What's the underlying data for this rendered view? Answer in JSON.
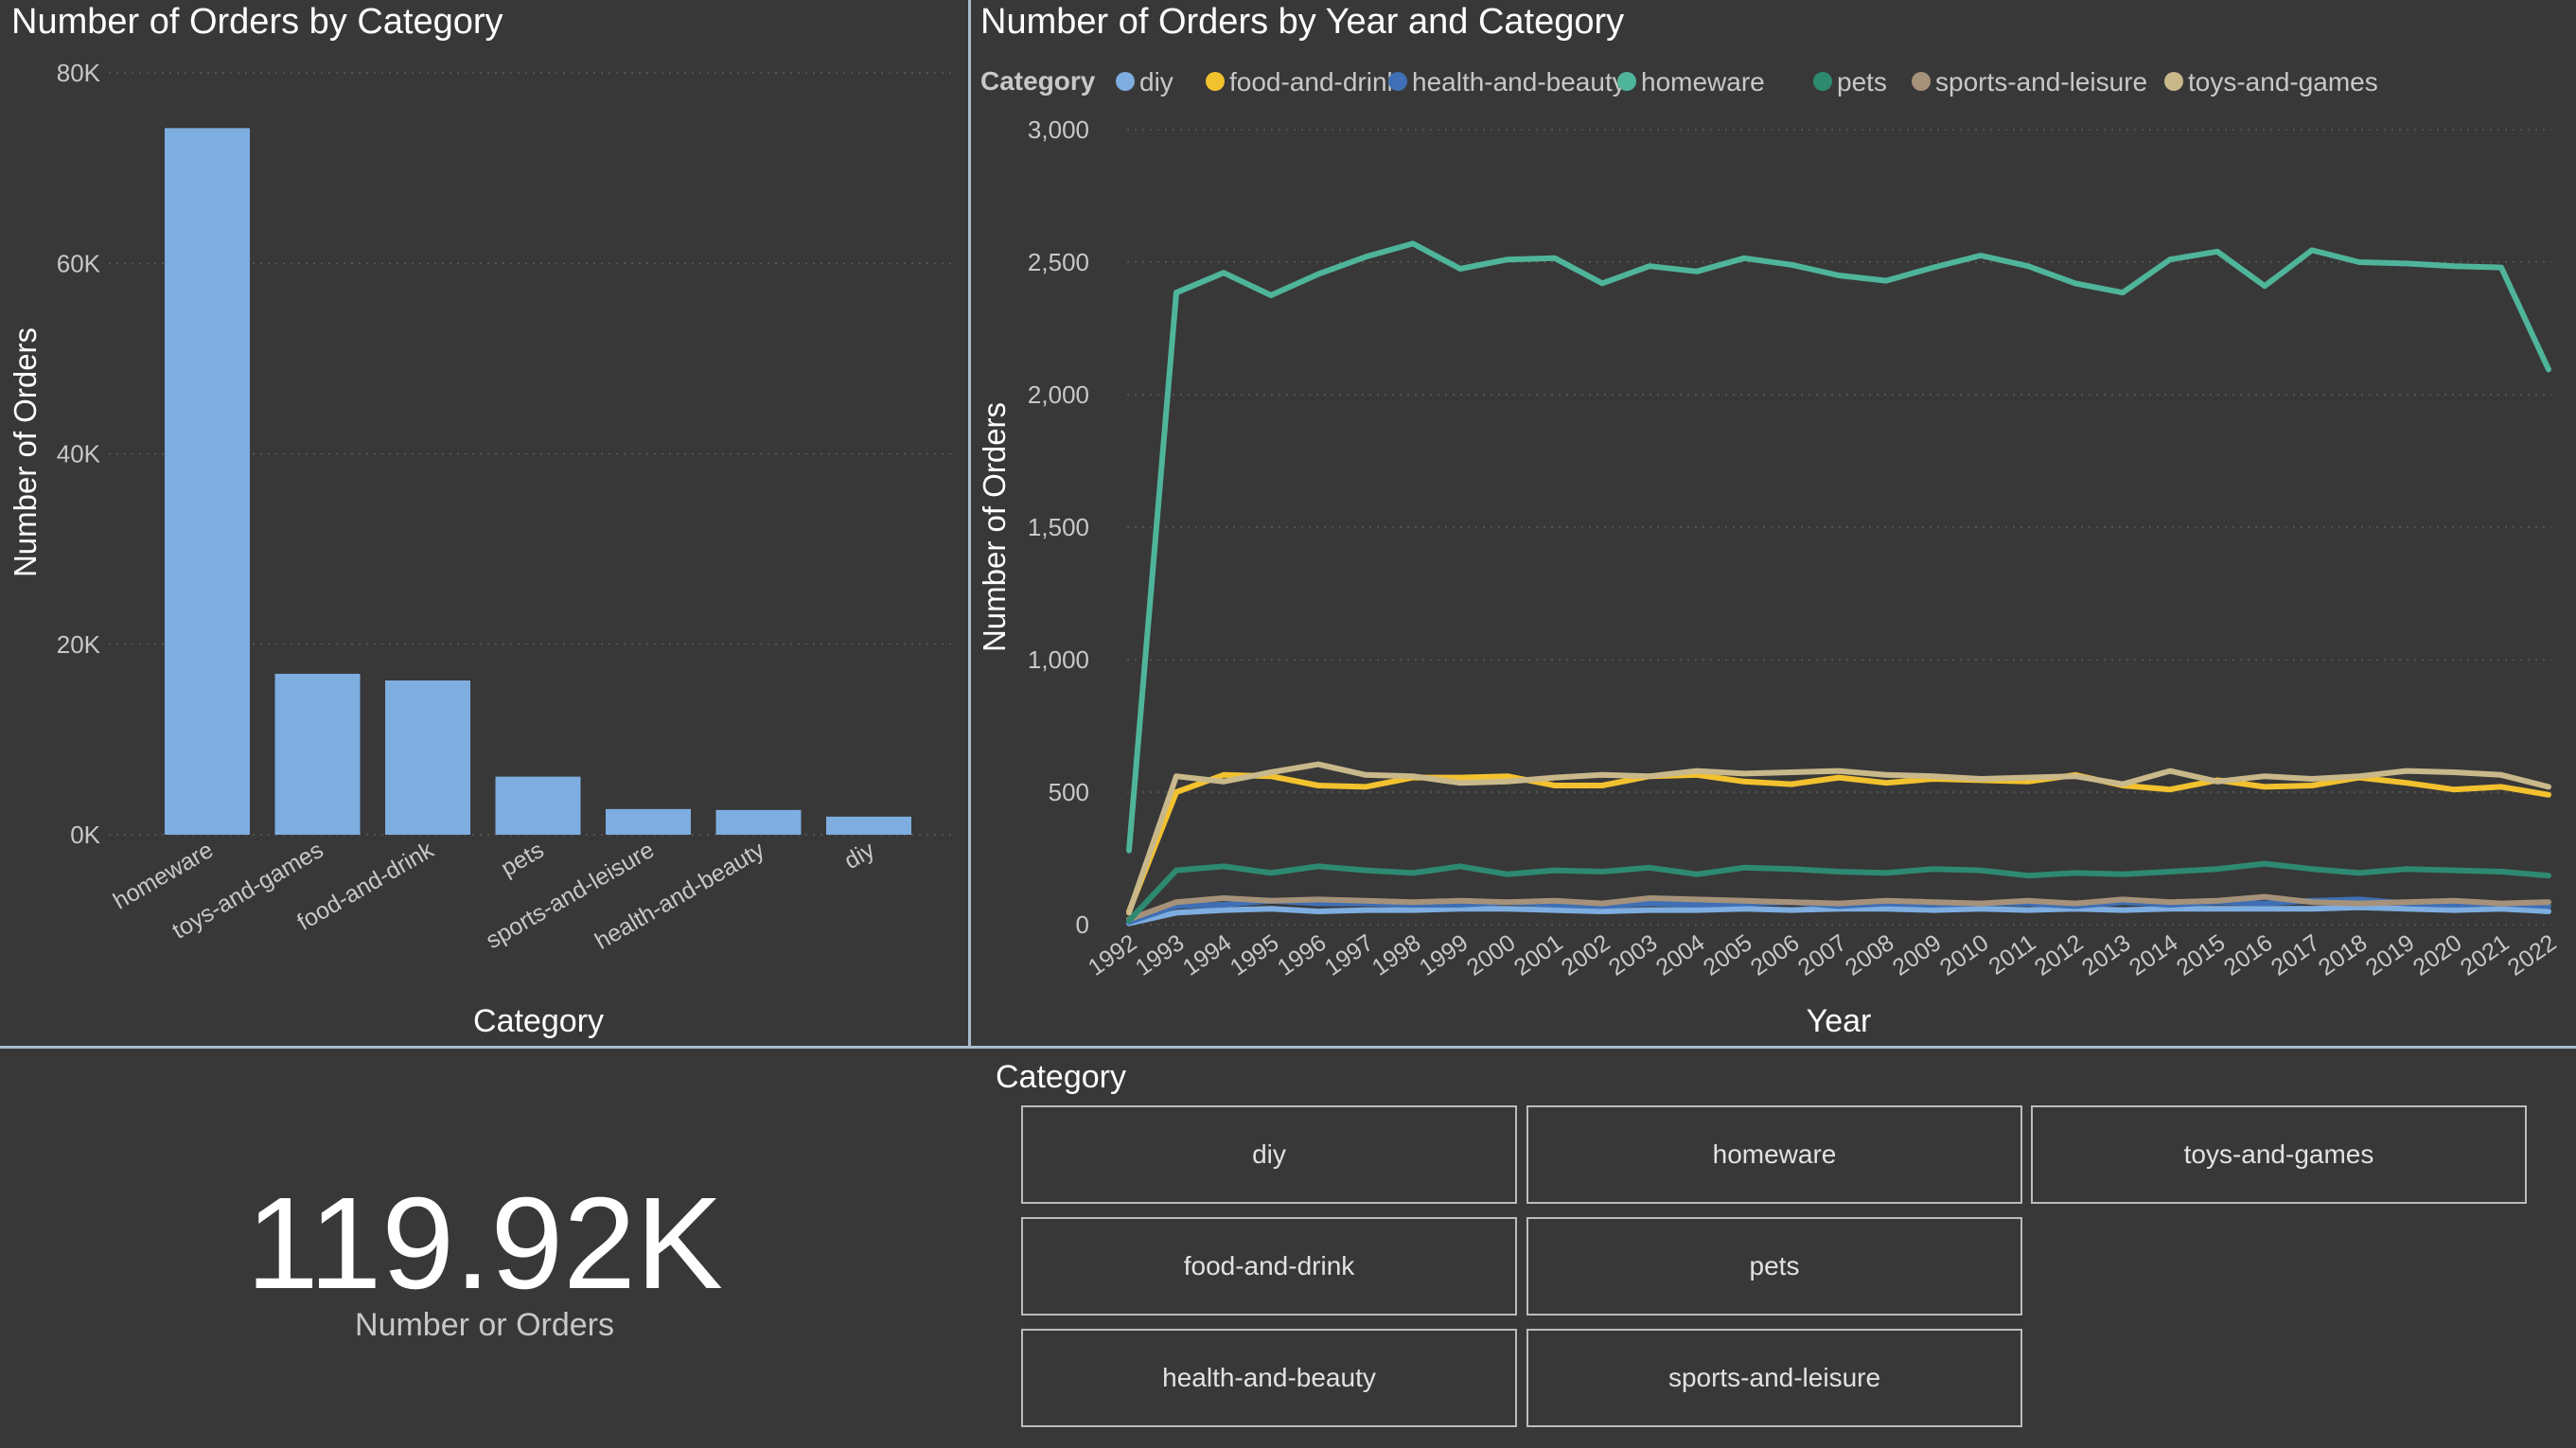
{
  "bar_chart": {
    "title": "Number of Orders by Category",
    "xlabel": "Category",
    "ylabel": "Number of Orders",
    "y_ticks": [
      "0K",
      "20K",
      "40K",
      "60K",
      "80K"
    ],
    "color": "#7eade0"
  },
  "line_chart": {
    "title": "Number of Orders by Year and Category",
    "legend_title": "Category",
    "xlabel": "Year",
    "ylabel": "Number of Orders",
    "y_ticks": [
      "0",
      "500",
      "1,000",
      "1,500",
      "2,000",
      "2,500",
      "3,000"
    ]
  },
  "chart_data": [
    {
      "type": "bar",
      "title": "Number of Orders by Category",
      "xlabel": "Category",
      "ylabel": "Number of Orders",
      "ylim": [
        0,
        80000
      ],
      "grid": true,
      "categories": [
        "homeware",
        "toys-and-games",
        "food-and-drink",
        "pets",
        "sports-and-leisure",
        "health-and-beauty",
        "diy"
      ],
      "values": [
        74200,
        16900,
        16200,
        6100,
        2700,
        2600,
        1900
      ]
    },
    {
      "type": "line",
      "title": "Number of Orders by Year and Category",
      "xlabel": "Year",
      "ylabel": "Number of Orders",
      "ylim": [
        0,
        3000
      ],
      "grid": true,
      "legend_position": "top-left",
      "x": [
        1992,
        1993,
        1994,
        1995,
        1996,
        1997,
        1998,
        1999,
        2000,
        2001,
        2002,
        2003,
        2004,
        2005,
        2006,
        2007,
        2008,
        2009,
        2010,
        2011,
        2012,
        2013,
        2014,
        2015,
        2016,
        2017,
        2018,
        2019,
        2020,
        2021,
        2022
      ],
      "series": [
        {
          "name": "diy",
          "color": "#7eade0",
          "values": [
            5,
            45,
            55,
            60,
            50,
            55,
            55,
            60,
            60,
            55,
            50,
            55,
            55,
            60,
            55,
            60,
            60,
            55,
            60,
            55,
            60,
            55,
            60,
            60,
            60,
            60,
            65,
            60,
            55,
            60,
            50
          ]
        },
        {
          "name": "food-and-drink",
          "color": "#f2c12e",
          "values": [
            50,
            500,
            565,
            560,
            525,
            520,
            555,
            555,
            560,
            525,
            525,
            560,
            565,
            540,
            530,
            555,
            535,
            550,
            545,
            540,
            565,
            525,
            510,
            545,
            520,
            525,
            555,
            535,
            510,
            520,
            490
          ]
        },
        {
          "name": "health-and-beauty",
          "color": "#3f6fb4",
          "values": [
            10,
            70,
            75,
            90,
            80,
            80,
            75,
            75,
            85,
            75,
            70,
            80,
            75,
            80,
            85,
            70,
            80,
            75,
            80,
            80,
            70,
            85,
            75,
            85,
            80,
            90,
            95,
            80,
            75,
            80,
            70
          ]
        },
        {
          "name": "homeware",
          "color": "#4fb59a",
          "values": [
            280,
            2385,
            2460,
            2375,
            2455,
            2520,
            2570,
            2475,
            2510,
            2515,
            2420,
            2485,
            2465,
            2515,
            2490,
            2450,
            2430,
            2480,
            2525,
            2485,
            2420,
            2385,
            2510,
            2540,
            2410,
            2545,
            2500,
            2495,
            2485,
            2480,
            2095
          ]
        },
        {
          "name": "pets",
          "color": "#2d8a70",
          "values": [
            15,
            205,
            220,
            195,
            220,
            205,
            195,
            220,
            190,
            205,
            200,
            215,
            190,
            215,
            210,
            200,
            195,
            210,
            205,
            185,
            195,
            190,
            200,
            210,
            230,
            210,
            195,
            210,
            205,
            200,
            185
          ]
        },
        {
          "name": "sports-and-leisure",
          "color": "#a6927a",
          "values": [
            20,
            85,
            100,
            90,
            95,
            90,
            85,
            90,
            85,
            90,
            80,
            100,
            95,
            90,
            85,
            80,
            90,
            85,
            80,
            90,
            80,
            95,
            85,
            90,
            105,
            85,
            80,
            85,
            90,
            80,
            85
          ]
        },
        {
          "name": "toys-and-games",
          "color": "#c9b88a",
          "values": [
            45,
            560,
            540,
            575,
            605,
            565,
            560,
            535,
            540,
            555,
            565,
            560,
            580,
            570,
            575,
            580,
            565,
            560,
            550,
            555,
            560,
            530,
            580,
            540,
            560,
            550,
            560,
            580,
            575,
            565,
            520
          ]
        }
      ]
    }
  ],
  "kpi": {
    "value": "119.92K",
    "label": "Number or Orders"
  },
  "slicer": {
    "title": "Category",
    "items": [
      "diy",
      "homeware",
      "toys-and-games",
      "food-and-drink",
      "pets",
      "health-and-beauty",
      "sports-and-leisure"
    ]
  }
}
